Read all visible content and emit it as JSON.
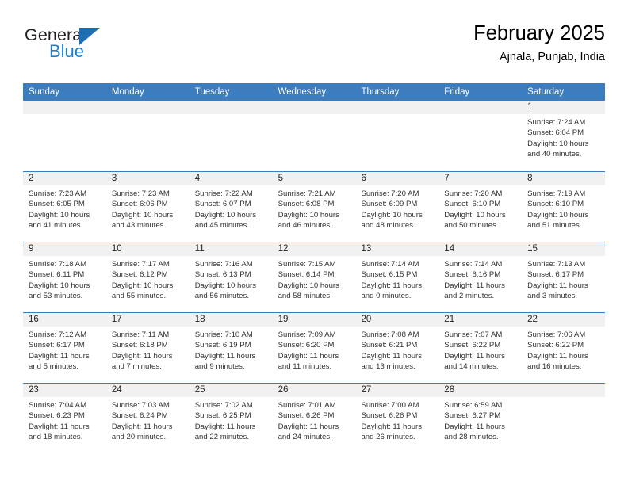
{
  "brand": {
    "name_top": "General",
    "name_bottom": "Blue",
    "triangle_color": "#1c6fb5",
    "blue_color": "#1c7fd0"
  },
  "header": {
    "title": "February 2025",
    "subtitle": "Ajnala, Punjab, India"
  },
  "theme": {
    "header_blue": "#3b7dbf",
    "day_band_gray": "#f1f1f1",
    "text_color": "#333333"
  },
  "weekdays": [
    "Sunday",
    "Monday",
    "Tuesday",
    "Wednesday",
    "Thursday",
    "Friday",
    "Saturday"
  ],
  "weeks": [
    [
      {
        "day": ""
      },
      {
        "day": ""
      },
      {
        "day": ""
      },
      {
        "day": ""
      },
      {
        "day": ""
      },
      {
        "day": ""
      },
      {
        "day": "1",
        "sunrise": "Sunrise: 7:24 AM",
        "sunset": "Sunset: 6:04 PM",
        "daylight": "Daylight: 10 hours and 40 minutes."
      }
    ],
    [
      {
        "day": "2",
        "sunrise": "Sunrise: 7:23 AM",
        "sunset": "Sunset: 6:05 PM",
        "daylight": "Daylight: 10 hours and 41 minutes."
      },
      {
        "day": "3",
        "sunrise": "Sunrise: 7:23 AM",
        "sunset": "Sunset: 6:06 PM",
        "daylight": "Daylight: 10 hours and 43 minutes."
      },
      {
        "day": "4",
        "sunrise": "Sunrise: 7:22 AM",
        "sunset": "Sunset: 6:07 PM",
        "daylight": "Daylight: 10 hours and 45 minutes."
      },
      {
        "day": "5",
        "sunrise": "Sunrise: 7:21 AM",
        "sunset": "Sunset: 6:08 PM",
        "daylight": "Daylight: 10 hours and 46 minutes."
      },
      {
        "day": "6",
        "sunrise": "Sunrise: 7:20 AM",
        "sunset": "Sunset: 6:09 PM",
        "daylight": "Daylight: 10 hours and 48 minutes."
      },
      {
        "day": "7",
        "sunrise": "Sunrise: 7:20 AM",
        "sunset": "Sunset: 6:10 PM",
        "daylight": "Daylight: 10 hours and 50 minutes."
      },
      {
        "day": "8",
        "sunrise": "Sunrise: 7:19 AM",
        "sunset": "Sunset: 6:10 PM",
        "daylight": "Daylight: 10 hours and 51 minutes."
      }
    ],
    [
      {
        "day": "9",
        "sunrise": "Sunrise: 7:18 AM",
        "sunset": "Sunset: 6:11 PM",
        "daylight": "Daylight: 10 hours and 53 minutes."
      },
      {
        "day": "10",
        "sunrise": "Sunrise: 7:17 AM",
        "sunset": "Sunset: 6:12 PM",
        "daylight": "Daylight: 10 hours and 55 minutes."
      },
      {
        "day": "11",
        "sunrise": "Sunrise: 7:16 AM",
        "sunset": "Sunset: 6:13 PM",
        "daylight": "Daylight: 10 hours and 56 minutes."
      },
      {
        "day": "12",
        "sunrise": "Sunrise: 7:15 AM",
        "sunset": "Sunset: 6:14 PM",
        "daylight": "Daylight: 10 hours and 58 minutes."
      },
      {
        "day": "13",
        "sunrise": "Sunrise: 7:14 AM",
        "sunset": "Sunset: 6:15 PM",
        "daylight": "Daylight: 11 hours and 0 minutes."
      },
      {
        "day": "14",
        "sunrise": "Sunrise: 7:14 AM",
        "sunset": "Sunset: 6:16 PM",
        "daylight": "Daylight: 11 hours and 2 minutes."
      },
      {
        "day": "15",
        "sunrise": "Sunrise: 7:13 AM",
        "sunset": "Sunset: 6:17 PM",
        "daylight": "Daylight: 11 hours and 3 minutes."
      }
    ],
    [
      {
        "day": "16",
        "sunrise": "Sunrise: 7:12 AM",
        "sunset": "Sunset: 6:17 PM",
        "daylight": "Daylight: 11 hours and 5 minutes."
      },
      {
        "day": "17",
        "sunrise": "Sunrise: 7:11 AM",
        "sunset": "Sunset: 6:18 PM",
        "daylight": "Daylight: 11 hours and 7 minutes."
      },
      {
        "day": "18",
        "sunrise": "Sunrise: 7:10 AM",
        "sunset": "Sunset: 6:19 PM",
        "daylight": "Daylight: 11 hours and 9 minutes."
      },
      {
        "day": "19",
        "sunrise": "Sunrise: 7:09 AM",
        "sunset": "Sunset: 6:20 PM",
        "daylight": "Daylight: 11 hours and 11 minutes."
      },
      {
        "day": "20",
        "sunrise": "Sunrise: 7:08 AM",
        "sunset": "Sunset: 6:21 PM",
        "daylight": "Daylight: 11 hours and 13 minutes."
      },
      {
        "day": "21",
        "sunrise": "Sunrise: 7:07 AM",
        "sunset": "Sunset: 6:22 PM",
        "daylight": "Daylight: 11 hours and 14 minutes."
      },
      {
        "day": "22",
        "sunrise": "Sunrise: 7:06 AM",
        "sunset": "Sunset: 6:22 PM",
        "daylight": "Daylight: 11 hours and 16 minutes."
      }
    ],
    [
      {
        "day": "23",
        "sunrise": "Sunrise: 7:04 AM",
        "sunset": "Sunset: 6:23 PM",
        "daylight": "Daylight: 11 hours and 18 minutes."
      },
      {
        "day": "24",
        "sunrise": "Sunrise: 7:03 AM",
        "sunset": "Sunset: 6:24 PM",
        "daylight": "Daylight: 11 hours and 20 minutes."
      },
      {
        "day": "25",
        "sunrise": "Sunrise: 7:02 AM",
        "sunset": "Sunset: 6:25 PM",
        "daylight": "Daylight: 11 hours and 22 minutes."
      },
      {
        "day": "26",
        "sunrise": "Sunrise: 7:01 AM",
        "sunset": "Sunset: 6:26 PM",
        "daylight": "Daylight: 11 hours and 24 minutes."
      },
      {
        "day": "27",
        "sunrise": "Sunrise: 7:00 AM",
        "sunset": "Sunset: 6:26 PM",
        "daylight": "Daylight: 11 hours and 26 minutes."
      },
      {
        "day": "28",
        "sunrise": "Sunrise: 6:59 AM",
        "sunset": "Sunset: 6:27 PM",
        "daylight": "Daylight: 11 hours and 28 minutes."
      },
      {
        "day": ""
      }
    ]
  ]
}
